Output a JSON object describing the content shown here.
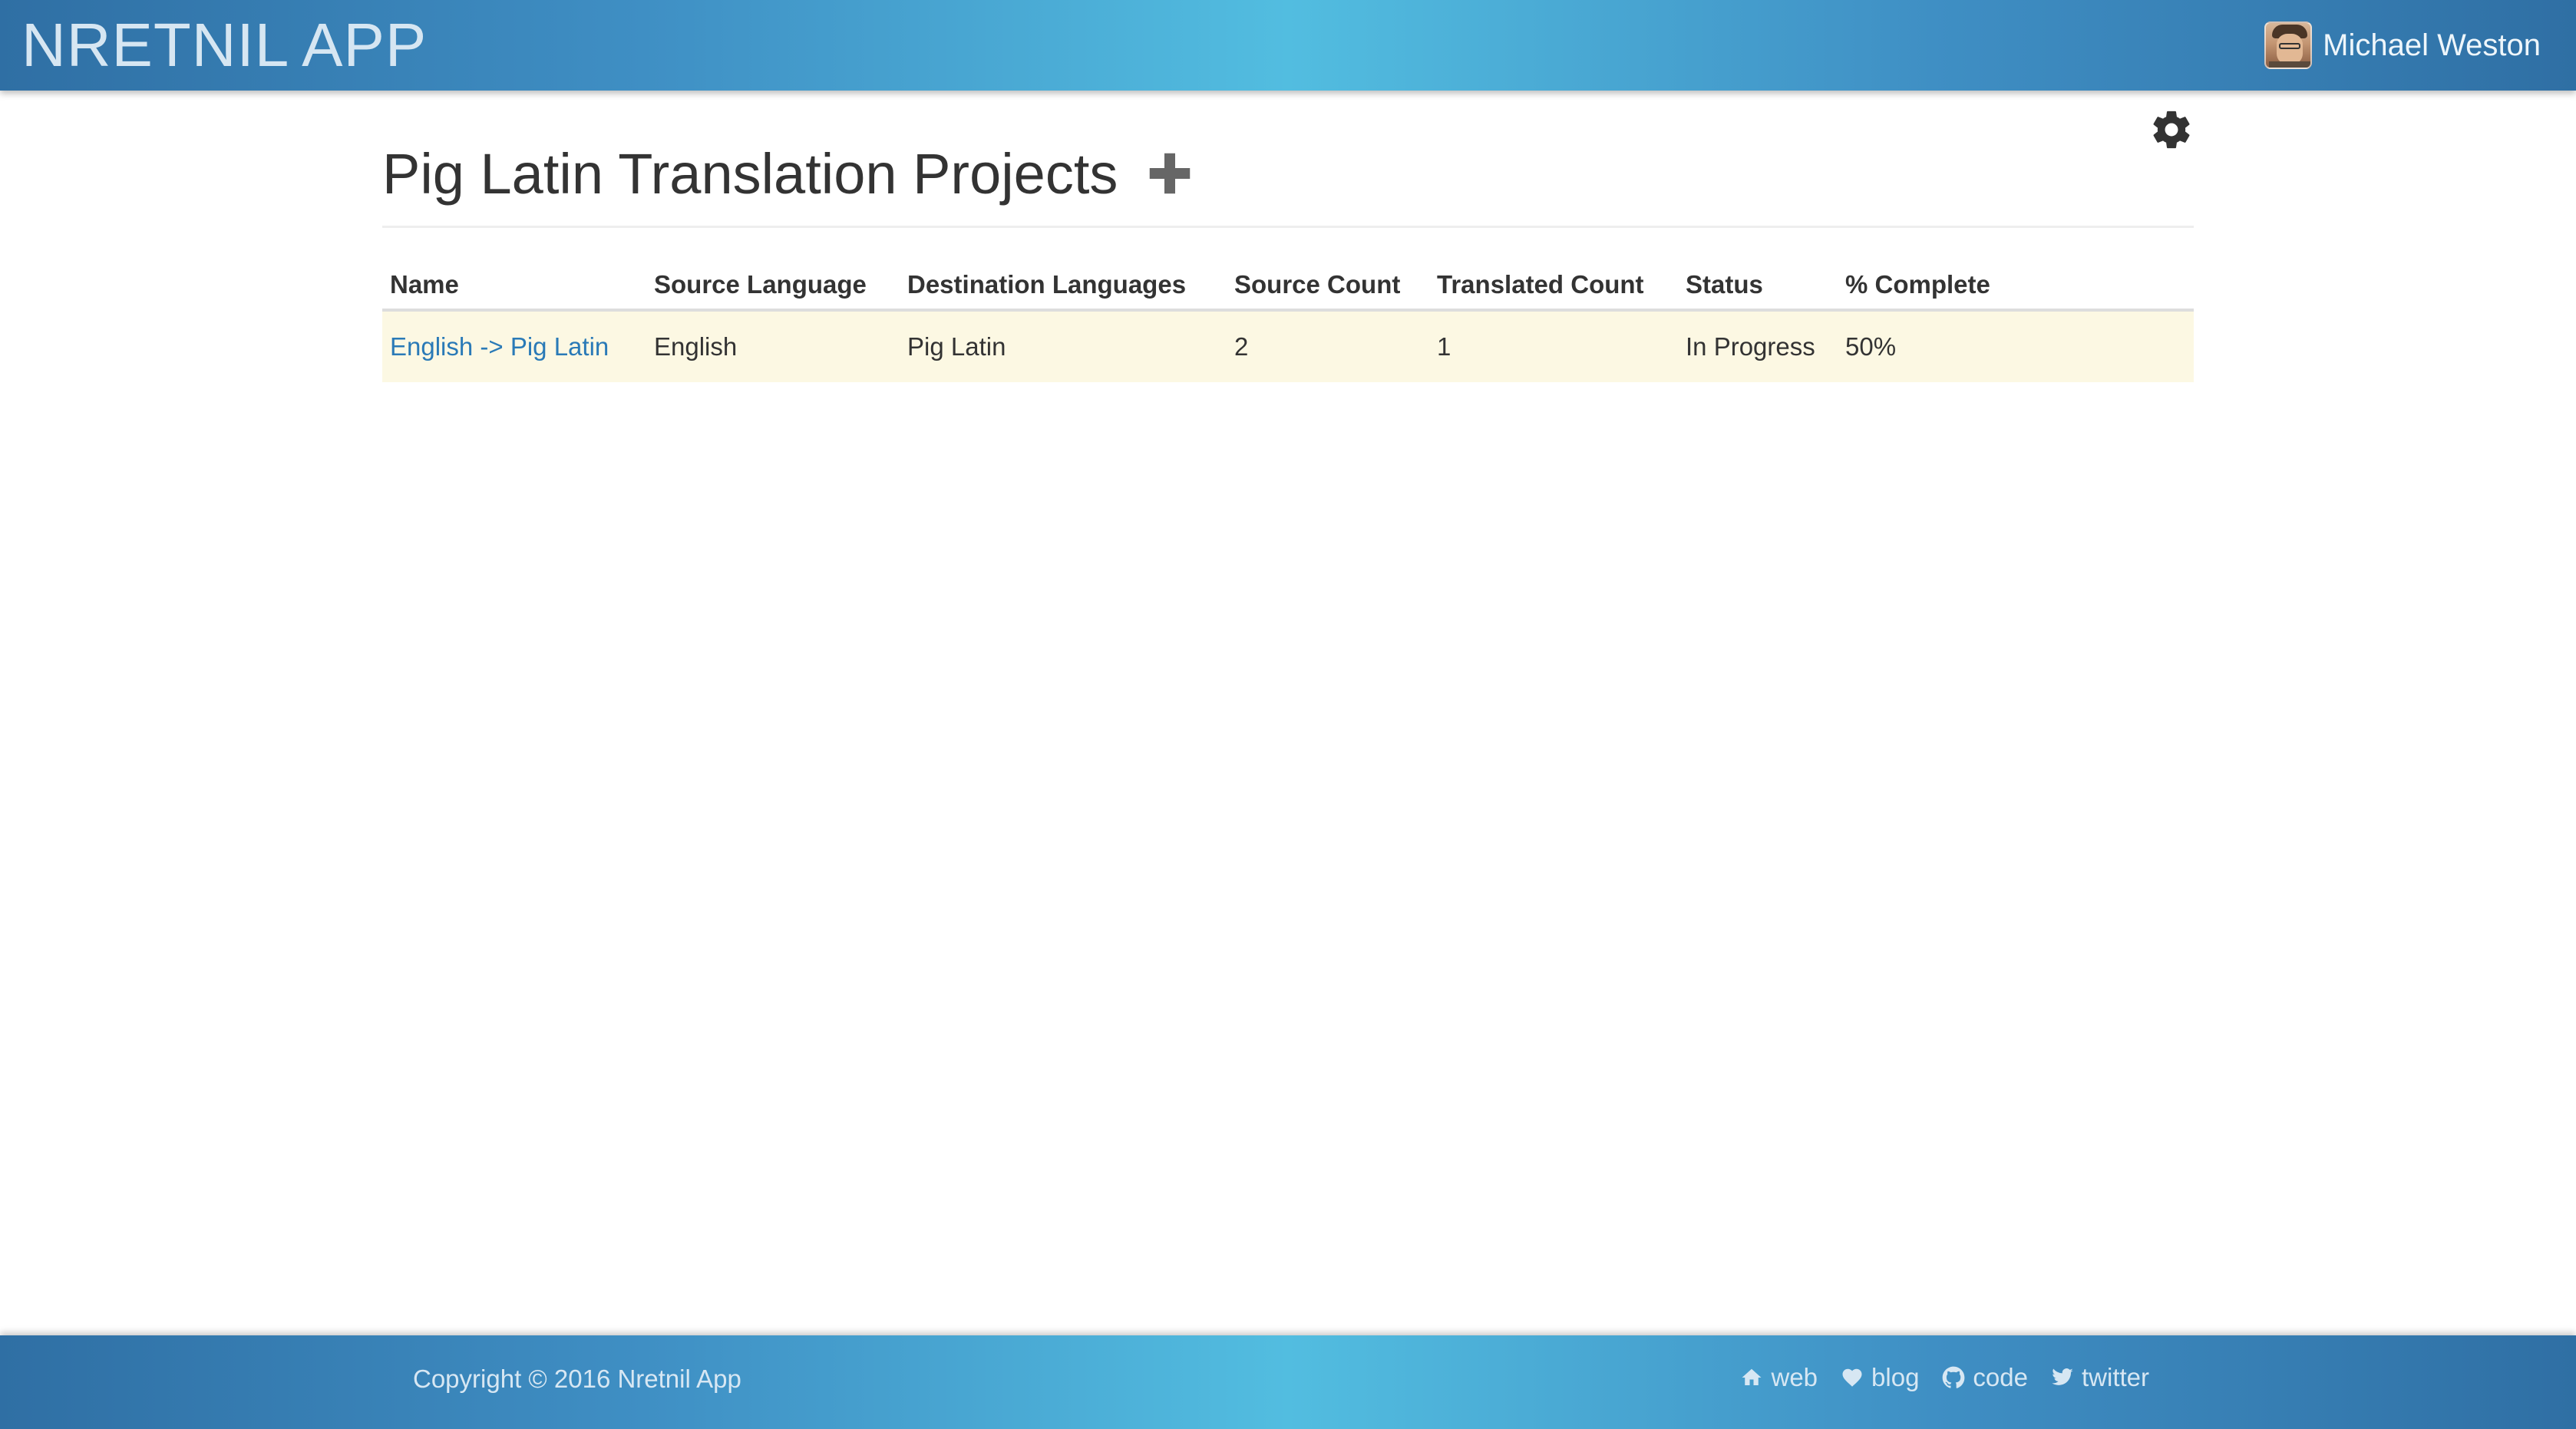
{
  "header": {
    "brand": "NRETNIL APP",
    "user_name": "Michael Weston"
  },
  "page": {
    "title": "Pig Latin Translation Projects"
  },
  "table": {
    "columns": [
      "Name",
      "Source Language",
      "Destination Languages",
      "Source Count",
      "Translated Count",
      "Status",
      "% Complete"
    ],
    "rows": [
      {
        "name": "English -> Pig Latin",
        "source_language": "English",
        "destination_languages": "Pig Latin",
        "source_count": "2",
        "translated_count": "1",
        "status": "In Progress",
        "complete": "50%"
      }
    ]
  },
  "footer": {
    "copyright": "Copyright © 2016 Nretnil App",
    "links": [
      {
        "label": "web",
        "icon": "home-icon"
      },
      {
        "label": "blog",
        "icon": "heart-icon"
      },
      {
        "label": "code",
        "icon": "github-icon"
      },
      {
        "label": "twitter",
        "icon": "twitter-icon"
      }
    ]
  },
  "colors": {
    "accent": "#3f8fc4",
    "link": "#2a7ab7",
    "row_highlight": "#fcf8e3"
  }
}
